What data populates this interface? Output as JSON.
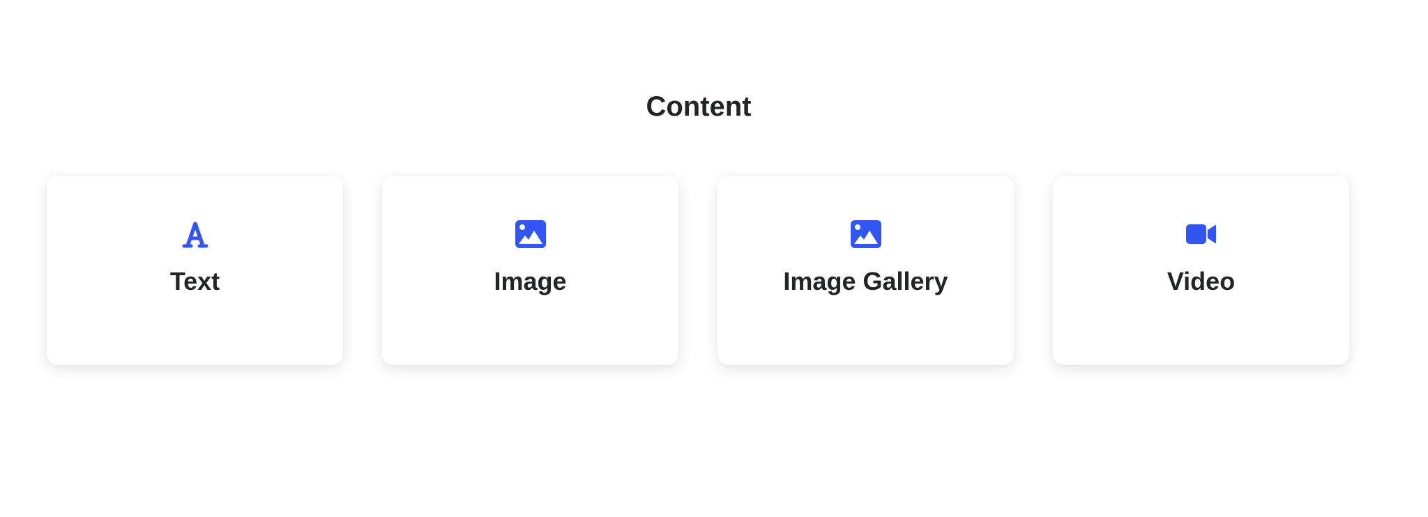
{
  "section": {
    "title": "Content"
  },
  "accent_color": "#3355f2",
  "cards": [
    {
      "label": "Text",
      "icon": "text-font-icon"
    },
    {
      "label": "Image",
      "icon": "image-icon"
    },
    {
      "label": "Image Gallery",
      "icon": "image-icon"
    },
    {
      "label": "Video",
      "icon": "video-camera-icon"
    }
  ]
}
